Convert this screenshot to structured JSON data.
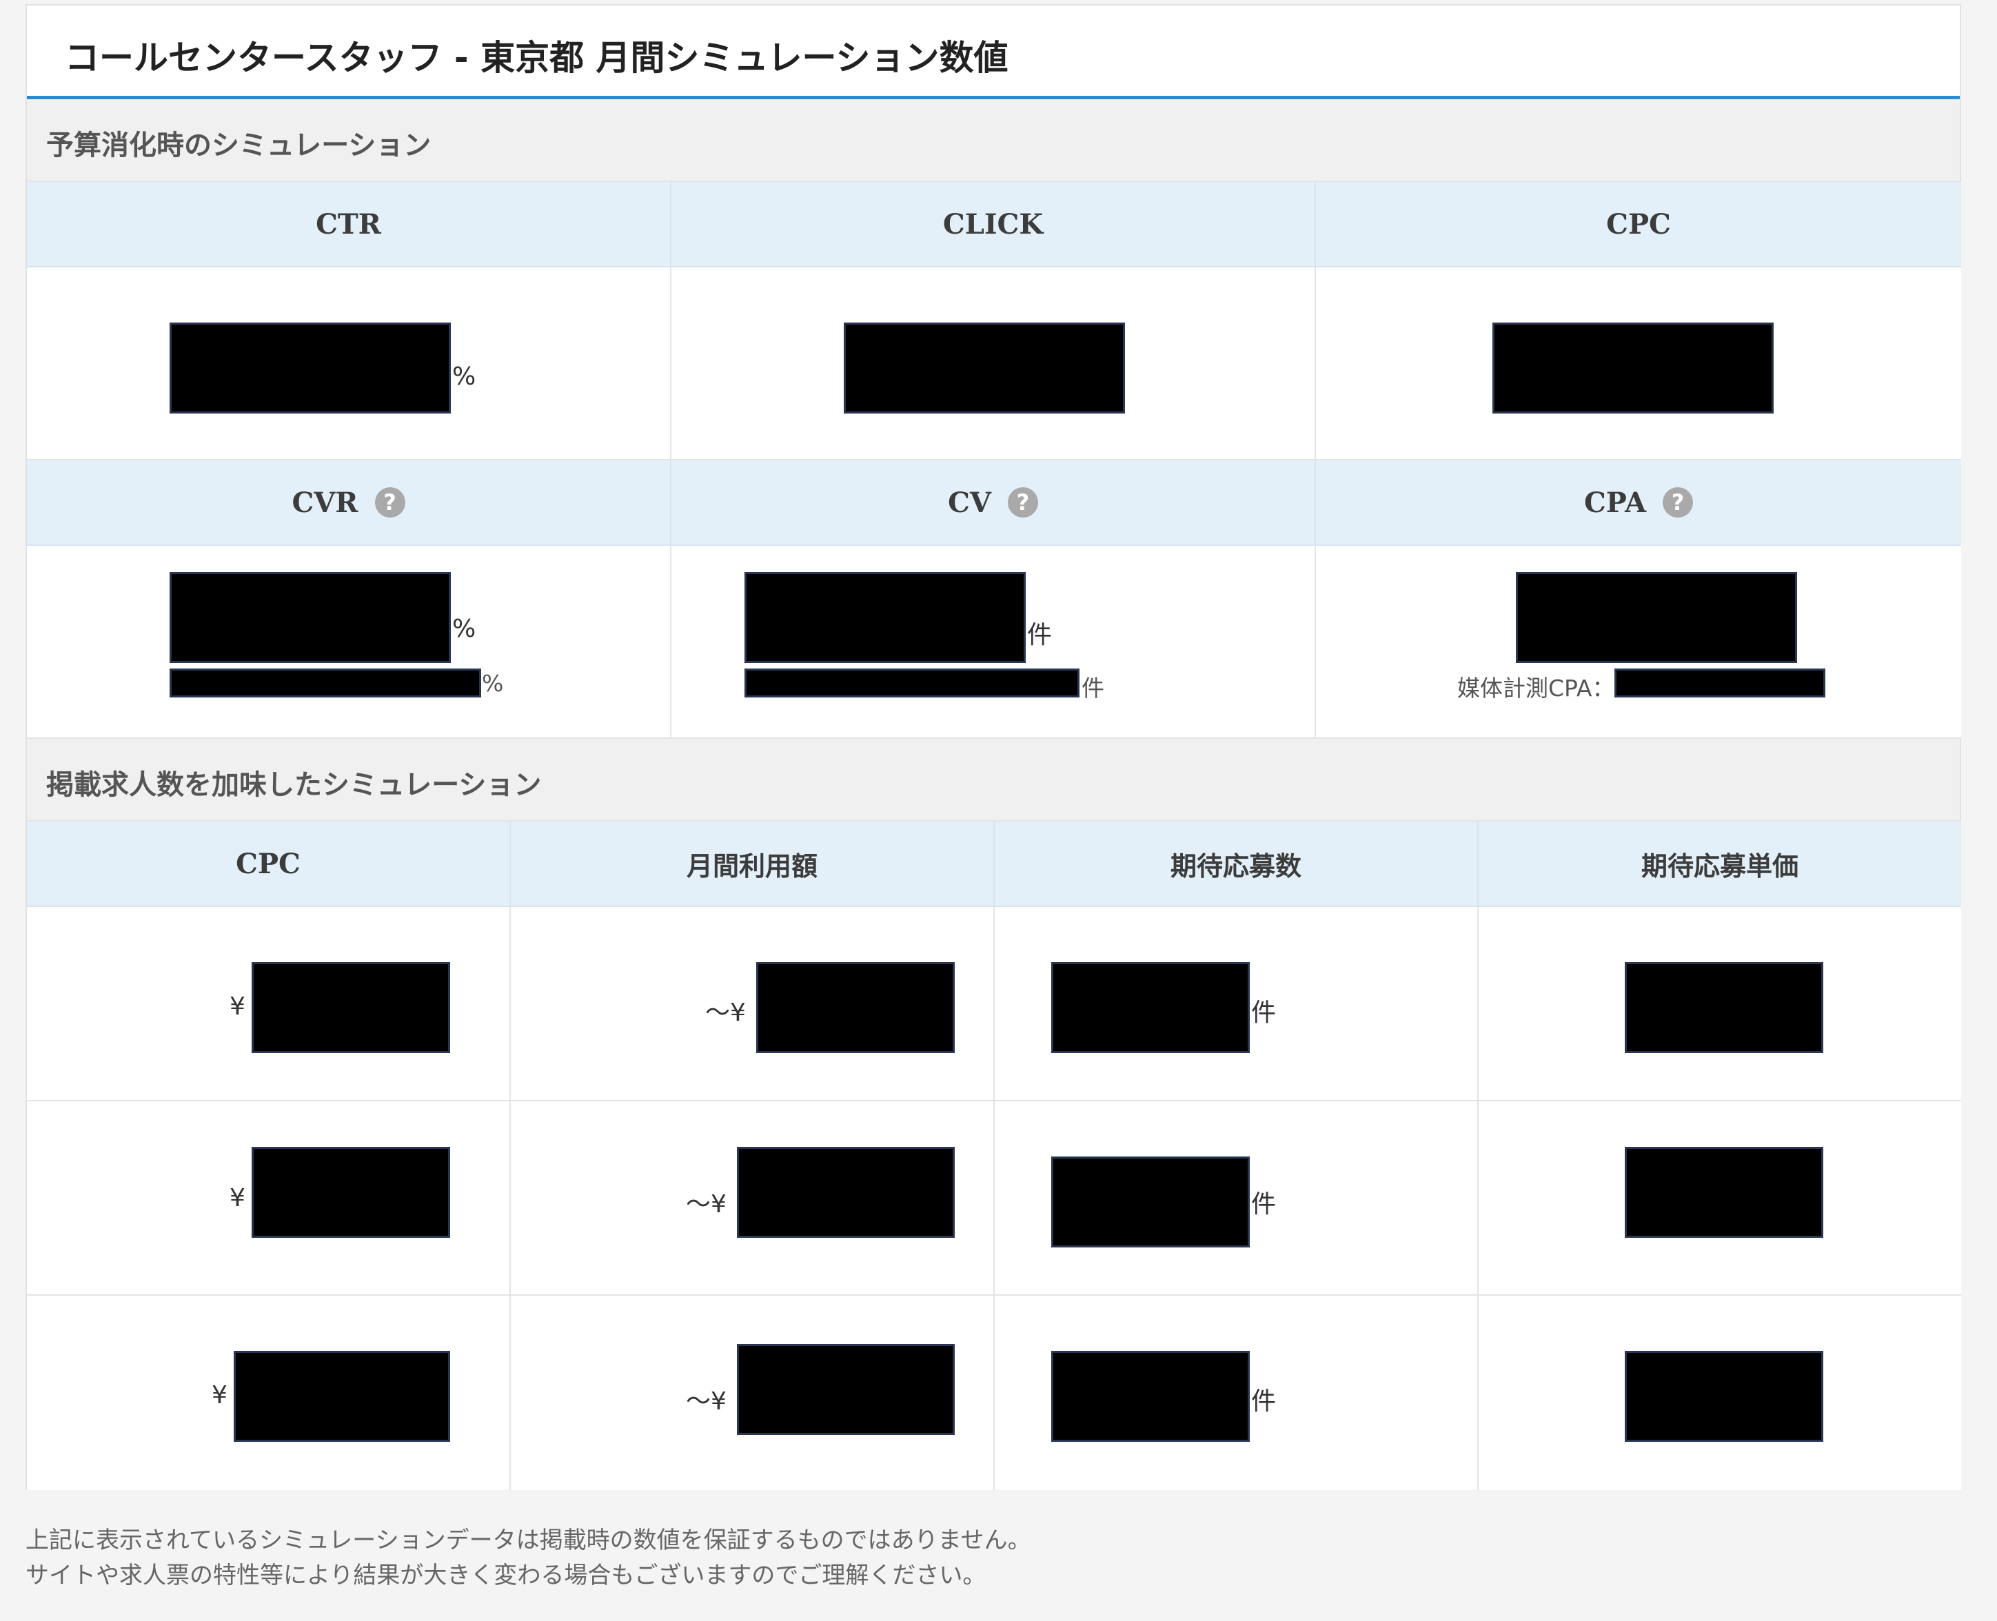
{
  "title": "コールセンタースタッフ - 東京都 月間シミュレーション数値",
  "section1": {
    "heading": "予算消化時のシミュレーション",
    "metrics_row1": [
      "CTR",
      "CLICK",
      "CPC"
    ],
    "metrics_row2": [
      "CVR",
      "CV",
      "CPA"
    ],
    "help_glyph": "?",
    "units": {
      "percent": "%",
      "count": "件",
      "yen": "¥",
      "media_cpa_label": "媒体計測CPA："
    }
  },
  "section2": {
    "heading": "掲載求人数を加味したシミュレーション",
    "columns": [
      "CPC",
      "月間利用額",
      "期待応募数",
      "期待応募単価"
    ],
    "units": {
      "yen": "¥",
      "range_yen": "～¥",
      "count": "件"
    }
  },
  "footer": {
    "line1": "上記に表示されているシミュレーションデータは掲載時の数値を保証するものではありません。",
    "line2": "サイトや求人票の特性等により結果が大きく変わる場合もございますのでご理解ください。"
  },
  "colors": {
    "accent": "#2b8bd2",
    "header_bg": "#e3f0f9",
    "section_bg": "#f0f0f0",
    "redaction": "#000000"
  },
  "icons": {
    "help": "question-circle-icon"
  }
}
